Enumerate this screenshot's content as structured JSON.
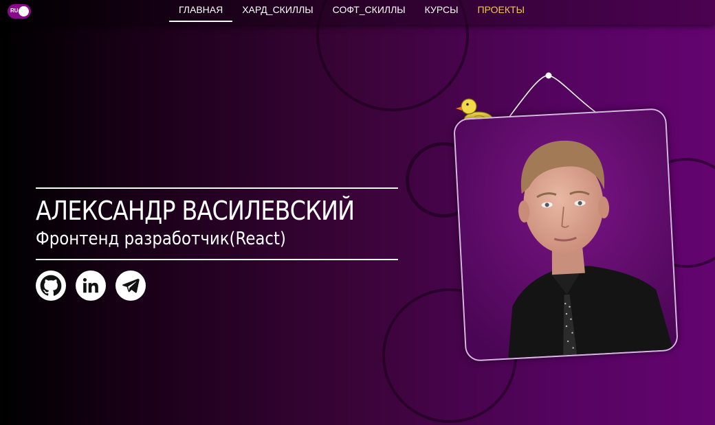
{
  "lang_toggle": {
    "label": "RU"
  },
  "nav": {
    "items": [
      {
        "label": "ГЛАВНАЯ"
      },
      {
        "label": "ХАРД_СКИЛЛЫ"
      },
      {
        "label": "СОФТ_СКИЛЛЫ"
      },
      {
        "label": "КУРСЫ"
      },
      {
        "label": "ПРОЕКТЫ"
      }
    ],
    "active_index": 0
  },
  "hero": {
    "name": "АЛЕКСАНДР ВАСИЛЕВСКИЙ",
    "role": "Фронтенд разработчик(React)"
  },
  "socials": [
    {
      "icon": "github-icon"
    },
    {
      "icon": "linkedin-icon"
    },
    {
      "icon": "telegram-icon"
    }
  ],
  "colors": {
    "highlight": "#f2c94c",
    "accent": "#8a0a8e",
    "text": "#ffffff"
  }
}
